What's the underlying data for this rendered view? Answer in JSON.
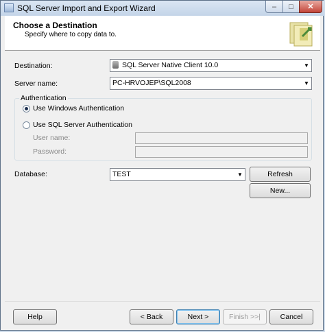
{
  "window": {
    "title": "SQL Server Import and Export Wizard",
    "controls": [
      "minimize-icon",
      "maximize-icon",
      "close-icon"
    ]
  },
  "header": {
    "title": "Choose a Destination",
    "subtitle": "Specify where to copy data to."
  },
  "form": {
    "destination_label": "Destination:",
    "destination_value": "SQL Server Native Client 10.0",
    "server_name_label": "Server name:",
    "server_name_value": "PC-HRVOJEP\\SQL2008",
    "authentication": {
      "legend": "Authentication",
      "windows_label": "Use Windows Authentication",
      "sql_label": "Use SQL Server Authentication",
      "selected": "windows",
      "username_label": "User name:",
      "username_value": "",
      "password_label": "Password:",
      "password_value": ""
    },
    "database_label": "Database:",
    "database_value": "TEST",
    "refresh_label": "Refresh",
    "new_label": "New..."
  },
  "footer": {
    "help_label": "Help",
    "back_label": "< Back",
    "next_label": "Next >",
    "finish_label": "Finish >>|",
    "cancel_label": "Cancel"
  },
  "colors": {
    "title_bar": "#c3d4e8",
    "close_button": "#c4463a",
    "window_bg": "#f0f0f0"
  }
}
